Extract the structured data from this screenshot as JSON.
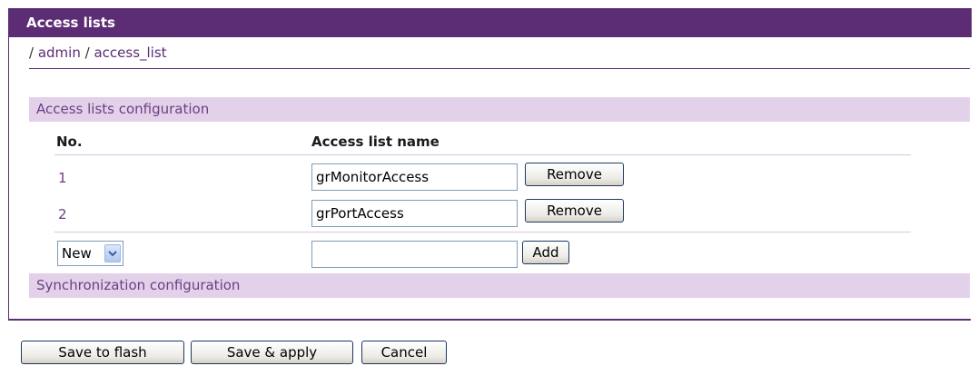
{
  "panel": {
    "title": "Access lists",
    "breadcrumb": {
      "sep1": "/",
      "admin": "admin",
      "sep2": "/",
      "current": "access_list"
    }
  },
  "access_lists_section": {
    "title": "Access lists configuration",
    "columns": {
      "no": "No.",
      "name": "Access list name"
    },
    "rows": [
      {
        "no": "1",
        "name": "grMonitorAccess",
        "action": "Remove"
      },
      {
        "no": "2",
        "name": "grPortAccess",
        "action": "Remove"
      }
    ],
    "new_row": {
      "select_value": "New",
      "input_value": "",
      "action": "Add"
    }
  },
  "sync_section": {
    "title": "Synchronization configuration"
  },
  "footer_buttons": {
    "save_flash": "Save to flash",
    "save_apply": "Save & apply",
    "cancel": "Cancel"
  }
}
